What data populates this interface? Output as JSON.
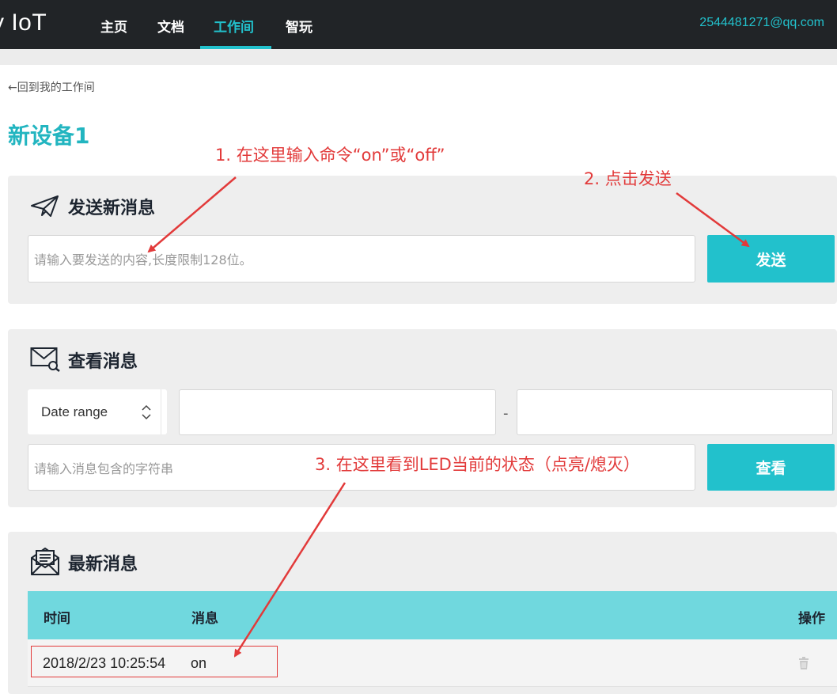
{
  "nav": {
    "brand": "y IoT",
    "items": [
      {
        "label": "主页",
        "active": false
      },
      {
        "label": "文档",
        "active": false
      },
      {
        "label": "工作间",
        "active": true
      },
      {
        "label": "智玩",
        "active": false
      }
    ],
    "user_email": "2544481271@qq.com"
  },
  "page": {
    "back_link": "←回到我的工作间",
    "device_title": "新设备1"
  },
  "send_panel": {
    "title": "发送新消息",
    "icon": "paper-plane-icon",
    "input_placeholder": "请输入要发送的内容,长度限制128位。",
    "button_label": "发送"
  },
  "view_panel": {
    "title": "查看消息",
    "icon": "envelope-search-icon",
    "date_select": "Date range",
    "start_date": "",
    "end_date": "",
    "separator": "-",
    "filter_placeholder": "请输入消息包含的字符串",
    "button_label": "查看"
  },
  "latest_panel": {
    "title": "最新消息",
    "icon": "open-envelope-icon",
    "columns": {
      "time": "时间",
      "message": "消息",
      "action": "操作"
    },
    "rows": [
      {
        "time": "2018/2/23 10:25:54",
        "message": "on",
        "action_icon": "trash-icon"
      }
    ]
  },
  "annotations": {
    "step1": "1. 在这里输入命令“on”或“off”",
    "step2": "2. 点击发送",
    "step3": "3. 在这里看到LED当前的状态（点亮/熄灭）",
    "color": "#e23a3a"
  },
  "colors": {
    "accent": "#22c1cc",
    "nav_bg": "#212427",
    "panel_bg": "#eeeeee",
    "table_head_bg": "#70d8de"
  }
}
